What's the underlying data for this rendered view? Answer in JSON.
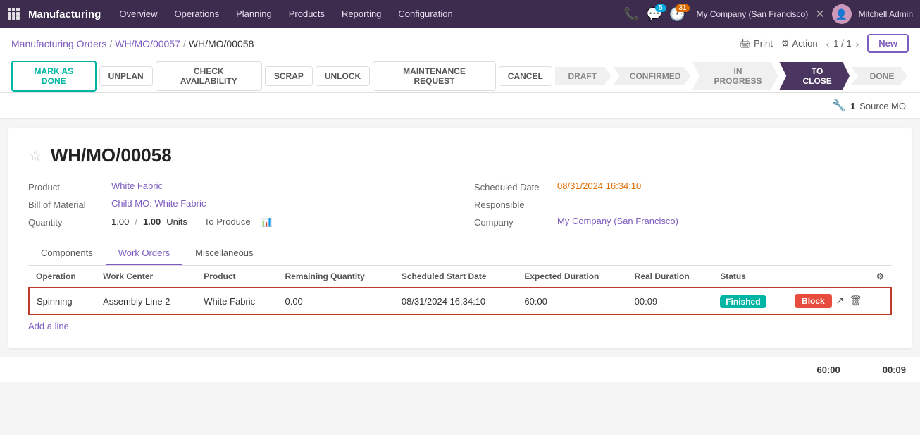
{
  "app": {
    "name": "Manufacturing",
    "nav_items": [
      "Overview",
      "Operations",
      "Planning",
      "Products",
      "Reporting",
      "Configuration"
    ]
  },
  "top_bar": {
    "notifications": {
      "chat_count": "5",
      "activity_count": "31"
    },
    "company": "My Company (San Francisco)",
    "user": "Mitchell Admin"
  },
  "breadcrumb": {
    "items": [
      "Manufacturing Orders",
      "WH/MO/00057",
      "WH/MO/00058"
    ]
  },
  "breadcrumb_actions": {
    "print": "Print",
    "action": "Action",
    "pager": "1 / 1",
    "new_btn": "New"
  },
  "action_buttons": [
    {
      "id": "mark-as-done",
      "label": "MARK AS DONE",
      "primary": true
    },
    {
      "id": "unplan",
      "label": "UNPLAN",
      "primary": false
    },
    {
      "id": "check-availability",
      "label": "CHECK AVAILABILITY",
      "primary": false
    },
    {
      "id": "scrap",
      "label": "SCRAP",
      "primary": false
    },
    {
      "id": "unlock",
      "label": "UNLOCK",
      "primary": false
    },
    {
      "id": "maintenance-request",
      "label": "MAINTENANCE REQUEST",
      "primary": false
    },
    {
      "id": "cancel",
      "label": "CANCEL",
      "primary": false
    }
  ],
  "status_steps": [
    {
      "id": "draft",
      "label": "DRAFT",
      "active": false
    },
    {
      "id": "confirmed",
      "label": "CONFIRMED",
      "active": false
    },
    {
      "id": "in-progress",
      "label": "IN PROGRESS",
      "active": false
    },
    {
      "id": "to-close",
      "label": "TO CLOSE",
      "active": true
    },
    {
      "id": "done",
      "label": "DONE",
      "active": false
    }
  ],
  "source_mo": {
    "count": "1",
    "label": "Source MO"
  },
  "form": {
    "title": "WH/MO/00058",
    "fields": {
      "product_label": "Product",
      "product_value": "White Fabric",
      "bom_label": "Bill of Material",
      "bom_value": "Child MO: White Fabric",
      "quantity_label": "Quantity",
      "quantity_value": "1.00",
      "quantity_divider": "/",
      "quantity_target": "1.00",
      "quantity_unit": "Units",
      "to_produce_label": "To Produce",
      "scheduled_date_label": "Scheduled Date",
      "scheduled_date_value": "08/31/2024 16:34:10",
      "responsible_label": "Responsible",
      "company_label": "Company",
      "company_value": "My Company (San Francisco)"
    }
  },
  "tabs": [
    {
      "id": "components",
      "label": "Components",
      "active": false
    },
    {
      "id": "work-orders",
      "label": "Work Orders",
      "active": true
    },
    {
      "id": "miscellaneous",
      "label": "Miscellaneous",
      "active": false
    }
  ],
  "table": {
    "columns": [
      "Operation",
      "Work Center",
      "Product",
      "Remaining Quantity",
      "Scheduled Start Date",
      "Expected Duration",
      "Real Duration",
      "Status"
    ],
    "rows": [
      {
        "operation": "Spinning",
        "work_center": "Assembly Line 2",
        "product": "White Fabric",
        "remaining_qty": "0.00",
        "scheduled_start": "08/31/2024 16:34:10",
        "expected_duration": "60:00",
        "real_duration": "00:09",
        "status": "Finished",
        "highlighted": true
      }
    ],
    "add_line": "Add a line"
  },
  "totals": {
    "expected_duration": "60:00",
    "real_duration": "00:09"
  }
}
